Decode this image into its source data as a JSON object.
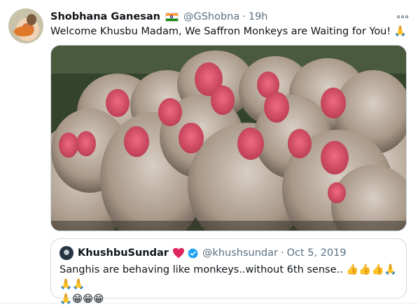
{
  "tweet": {
    "author_name": "Shobhana Ganesan",
    "flag_icon": "india-flag-icon",
    "handle": "@GShobna",
    "separator": "·",
    "time": "19h",
    "more_icon": "more-options-icon",
    "text": "Welcome Khusbu Madam, We Saffron Monkeys are Waiting for You! 🙏",
    "media_alt": "photo of a huddled group of red-faced macaque monkeys"
  },
  "quote": {
    "author_name": "KhushbuSundar",
    "heart_icon": "red-heart-icon",
    "verified_icon": "verified-badge-icon",
    "handle": "@khushsundar",
    "separator": "·",
    "date": "Oct 5, 2019",
    "line1": "Sanghis are behaving like monkeys..without 6th sense.. 👍👍👍🙏🙏🙏",
    "line2": "🙏😁😁😁"
  },
  "colors": {
    "text": "#0f1419",
    "secondary": "#5b7083",
    "border": "#cfd9de",
    "verified": "#1da1f2",
    "heart": "#e0245e",
    "monkey_face": "#e0506a",
    "monkey_fur": "#b8a99a"
  }
}
